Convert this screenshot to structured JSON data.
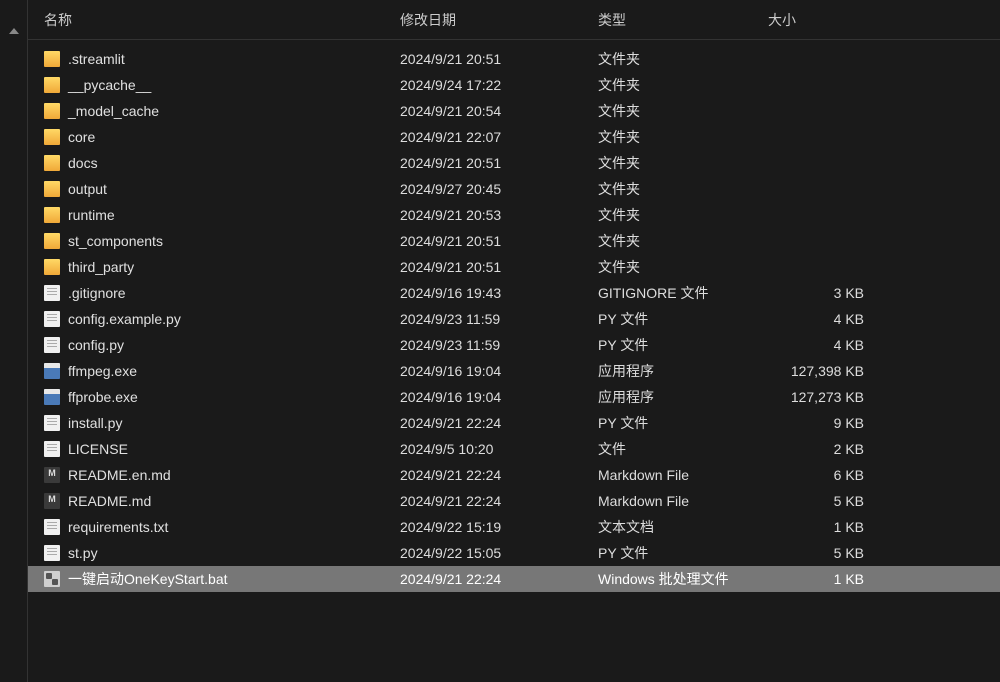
{
  "columns": {
    "name": "名称",
    "date": "修改日期",
    "type": "类型",
    "size": "大小"
  },
  "files": [
    {
      "icon": "folder",
      "name": ".streamlit",
      "date": "2024/9/21 20:51",
      "type": "文件夹",
      "size": "",
      "selected": false
    },
    {
      "icon": "folder",
      "name": "__pycache__",
      "date": "2024/9/24 17:22",
      "type": "文件夹",
      "size": "",
      "selected": false
    },
    {
      "icon": "folder",
      "name": "_model_cache",
      "date": "2024/9/21 20:54",
      "type": "文件夹",
      "size": "",
      "selected": false
    },
    {
      "icon": "folder",
      "name": "core",
      "date": "2024/9/21 22:07",
      "type": "文件夹",
      "size": "",
      "selected": false
    },
    {
      "icon": "folder",
      "name": "docs",
      "date": "2024/9/21 20:51",
      "type": "文件夹",
      "size": "",
      "selected": false
    },
    {
      "icon": "folder",
      "name": "output",
      "date": "2024/9/27 20:45",
      "type": "文件夹",
      "size": "",
      "selected": false
    },
    {
      "icon": "folder",
      "name": "runtime",
      "date": "2024/9/21 20:53",
      "type": "文件夹",
      "size": "",
      "selected": false
    },
    {
      "icon": "folder",
      "name": "st_components",
      "date": "2024/9/21 20:51",
      "type": "文件夹",
      "size": "",
      "selected": false
    },
    {
      "icon": "folder",
      "name": "third_party",
      "date": "2024/9/21 20:51",
      "type": "文件夹",
      "size": "",
      "selected": false
    },
    {
      "icon": "file",
      "name": ".gitignore",
      "date": "2024/9/16 19:43",
      "type": "GITIGNORE 文件",
      "size": "3 KB",
      "selected": false
    },
    {
      "icon": "file",
      "name": "config.example.py",
      "date": "2024/9/23 11:59",
      "type": "PY 文件",
      "size": "4 KB",
      "selected": false
    },
    {
      "icon": "file",
      "name": "config.py",
      "date": "2024/9/23 11:59",
      "type": "PY 文件",
      "size": "4 KB",
      "selected": false
    },
    {
      "icon": "exe",
      "name": "ffmpeg.exe",
      "date": "2024/9/16 19:04",
      "type": "应用程序",
      "size": "127,398 KB",
      "selected": false
    },
    {
      "icon": "exe",
      "name": "ffprobe.exe",
      "date": "2024/9/16 19:04",
      "type": "应用程序",
      "size": "127,273 KB",
      "selected": false
    },
    {
      "icon": "file",
      "name": "install.py",
      "date": "2024/9/21 22:24",
      "type": "PY 文件",
      "size": "9 KB",
      "selected": false
    },
    {
      "icon": "file",
      "name": "LICENSE",
      "date": "2024/9/5 10:20",
      "type": "文件",
      "size": "2 KB",
      "selected": false
    },
    {
      "icon": "md",
      "name": "README.en.md",
      "date": "2024/9/21 22:24",
      "type": "Markdown File",
      "size": "6 KB",
      "selected": false
    },
    {
      "icon": "md",
      "name": "README.md",
      "date": "2024/9/21 22:24",
      "type": "Markdown File",
      "size": "5 KB",
      "selected": false
    },
    {
      "icon": "file",
      "name": "requirements.txt",
      "date": "2024/9/22 15:19",
      "type": "文本文档",
      "size": "1 KB",
      "selected": false
    },
    {
      "icon": "file",
      "name": "st.py",
      "date": "2024/9/22 15:05",
      "type": "PY 文件",
      "size": "5 KB",
      "selected": false
    },
    {
      "icon": "bat",
      "name": "一键启动OneKeyStart.bat",
      "date": "2024/9/21 22:24",
      "type": "Windows 批处理文件",
      "size": "1 KB",
      "selected": true
    }
  ]
}
